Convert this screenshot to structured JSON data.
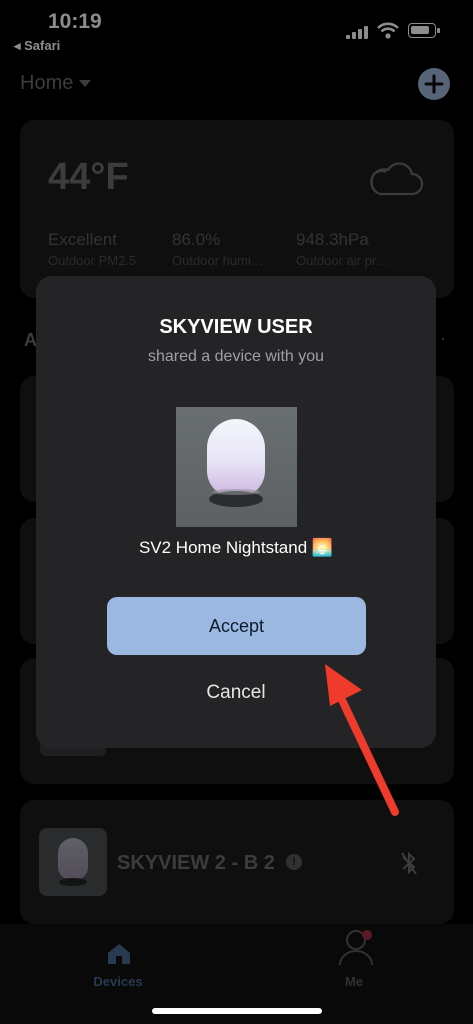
{
  "status_bar": {
    "time": "10:19",
    "back_app": "◂ Safari"
  },
  "header": {
    "home_label": "Home",
    "add_icon": "plus-icon"
  },
  "weather": {
    "temperature": "44°F",
    "icon": "cloud-icon",
    "metrics": [
      {
        "value": "Excellent",
        "label": "Outdoor PM2.5"
      },
      {
        "value": "86.0%",
        "label": "Outdoor humi…"
      },
      {
        "value": "948.3hPa",
        "label": "Outdoor air pr…"
      }
    ]
  },
  "section_partial": {
    "left": "A",
    "right": "·"
  },
  "device_card": {
    "name": "SKYVIEW 2 - B 2",
    "status_icon": "bluetooth-off-icon"
  },
  "share_dialog": {
    "title": "SKYVIEW USER",
    "subtitle": "shared a device with you",
    "device_name": "SV2 Home Nightstand 🌅",
    "accept_label": "Accept",
    "cancel_label": "Cancel"
  },
  "bottom_nav": {
    "tabs": [
      {
        "label": "Devices",
        "icon": "house-icon",
        "active": true
      },
      {
        "label": "Me",
        "icon": "person-icon",
        "active": false
      }
    ]
  },
  "colors": {
    "accent": "#9ab8e0",
    "annotation_arrow": "#ee3b2b",
    "badge": "#e0384a"
  }
}
